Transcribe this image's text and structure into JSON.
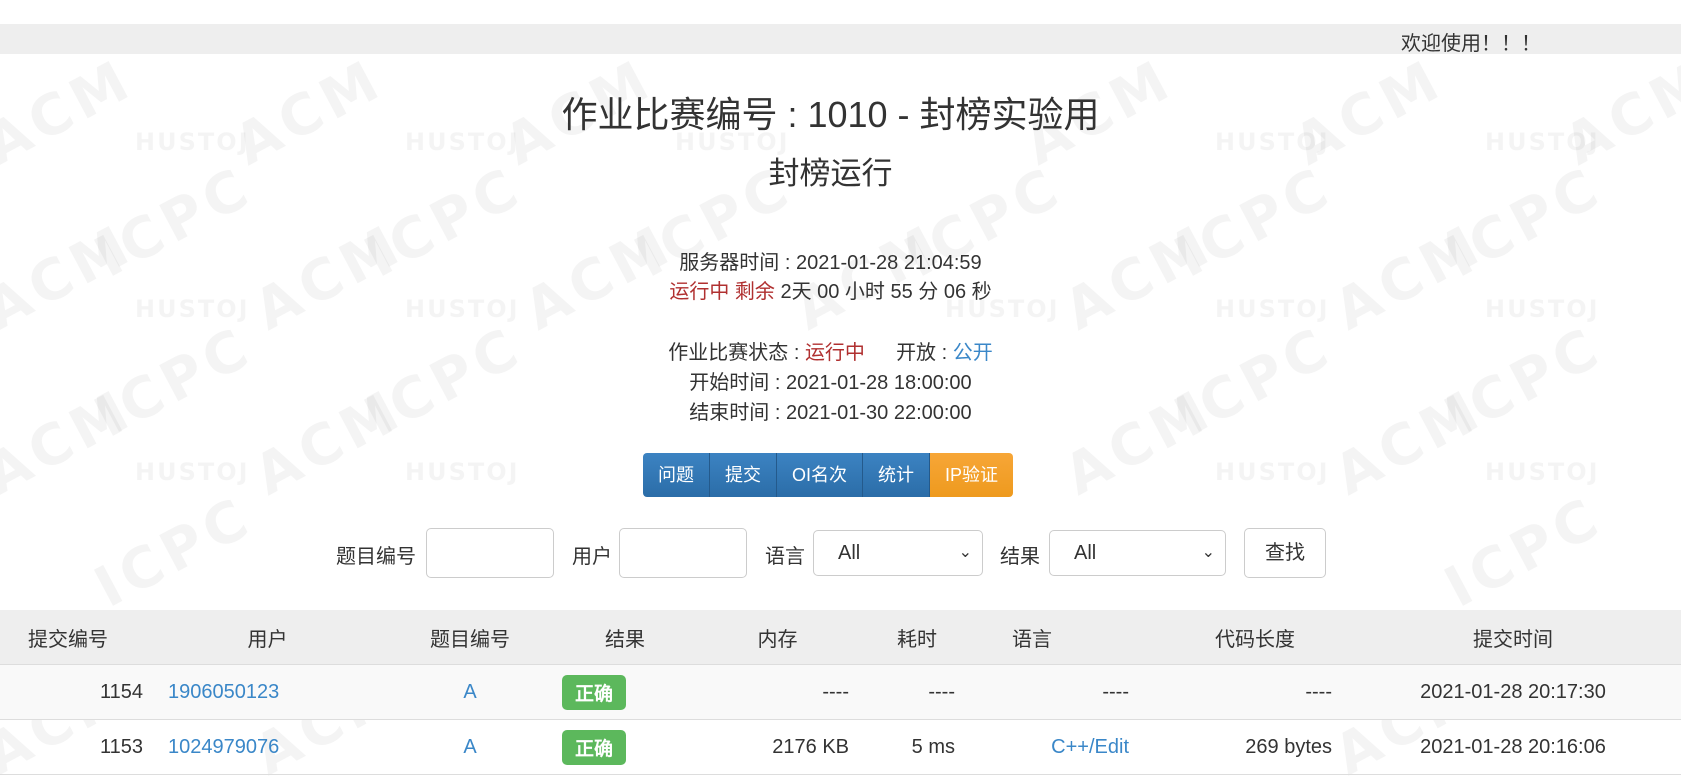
{
  "header": {
    "welcome": "欢迎使用！！！"
  },
  "contest": {
    "title": "作业比赛编号 : 1010 - 封榜实验用",
    "subtitle": "封榜运行",
    "server_time_label": "服务器时间 : ",
    "server_time": "2021-01-28 21:04:59",
    "running_remaining": "运行中 剩余",
    "remaining": " 2天 00 小时 55 分 06 秒",
    "status_label": "作业比赛状态 : ",
    "status": "运行中",
    "open_label": "开放 : ",
    "open": "公开",
    "start": "开始时间 : 2021-01-28 18:00:00",
    "end": "结束时间 : 2021-01-30 22:00:00"
  },
  "nav_buttons": [
    "问题",
    "提交",
    "OI名次",
    "统计",
    "IP验证"
  ],
  "filters": {
    "problem_label": "题目编号",
    "problem_value": "",
    "user_label": "用户",
    "user_value": "",
    "language_label": "语言",
    "language_value": "All",
    "result_label": "结果",
    "result_value": "All",
    "search_button": "查找"
  },
  "table": {
    "headers": [
      "提交编号",
      "用户",
      "题目编号",
      "结果",
      "内存",
      "耗时",
      "语言",
      "代码长度",
      "提交时间"
    ],
    "rows": [
      {
        "id": "1154",
        "user": "1906050123",
        "problem": "A",
        "result": "正确",
        "memory": "----",
        "time": "----",
        "language": "----",
        "length": "----",
        "submitted": "2021-01-28 20:17:30"
      },
      {
        "id": "1153",
        "user": "1024979076",
        "problem": "A",
        "result": "正确",
        "memory": "2176 KB",
        "time": "5 ms",
        "language": "C++/Edit",
        "length": "269 bytes",
        "submitted": "2021-01-28 20:16:06"
      }
    ]
  },
  "colors": {
    "accent_blue": "#3a87c8",
    "status_red": "#b03030",
    "success_green": "#5cb85c",
    "orange": "#f0a02a"
  }
}
